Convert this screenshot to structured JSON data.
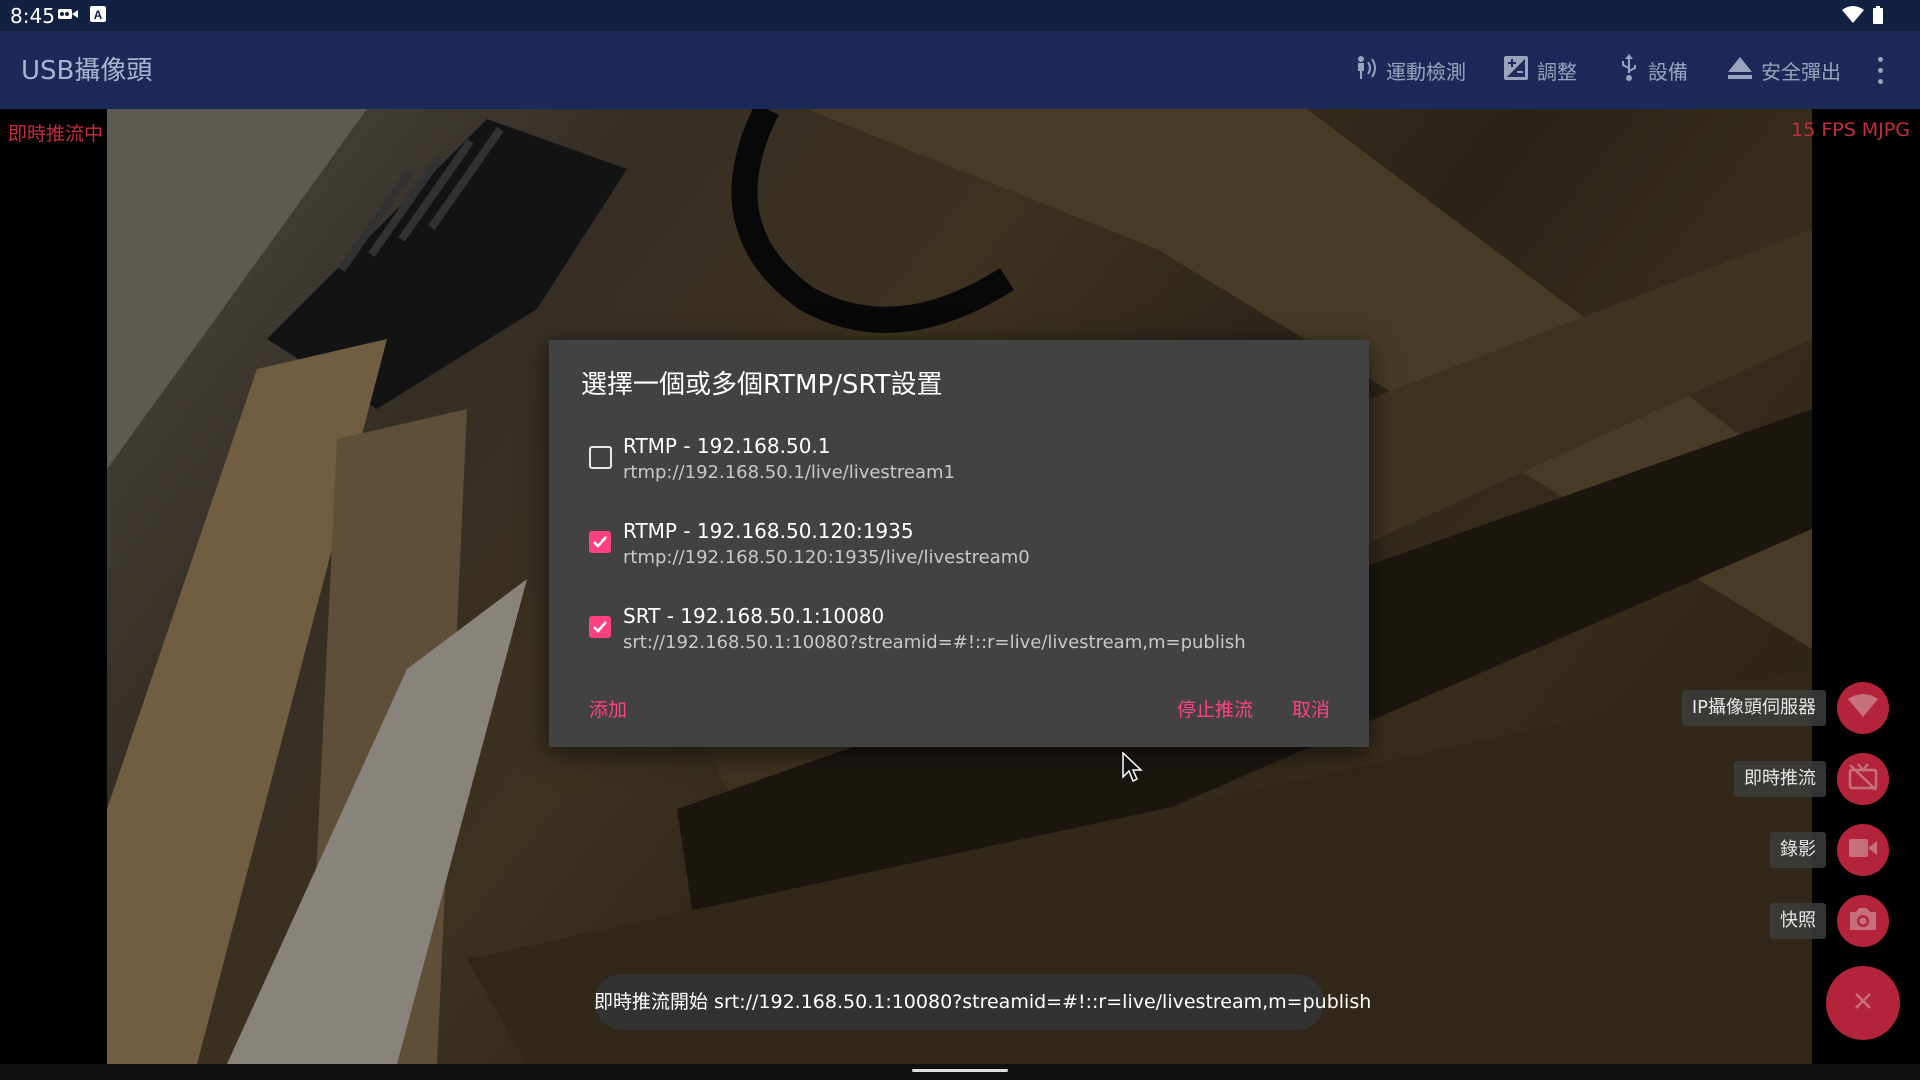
{
  "status_bar": {
    "time": "8:45",
    "icons": [
      "video-camera-icon",
      "keyboard-a-icon",
      "wifi-icon",
      "battery-icon"
    ]
  },
  "app_bar": {
    "title": "USB攝像頭",
    "actions": [
      {
        "icon": "motion-detect-icon",
        "label": "運動檢測"
      },
      {
        "icon": "adjust-icon",
        "label": "調整"
      },
      {
        "icon": "usb-icon",
        "label": "設備"
      },
      {
        "icon": "eject-icon",
        "label": "安全彈出"
      }
    ],
    "overflow_icon": "more-vert-icon"
  },
  "camera": {
    "status_left": "即時推流中",
    "status_right": "15 FPS MJPG"
  },
  "dialog": {
    "title": "選擇一個或多個RTMP/SRT設置",
    "items": [
      {
        "title": "RTMP - 192.168.50.1",
        "url": "rtmp://192.168.50.1/live/livestream1",
        "checked": false
      },
      {
        "title": "RTMP - 192.168.50.120:1935",
        "url": "rtmp://192.168.50.120:1935/live/livestream0",
        "checked": true
      },
      {
        "title": "SRT - 192.168.50.1:10080",
        "url": "srt://192.168.50.1:10080?streamid=#!::r=live/livestream,m=publish",
        "checked": true
      }
    ],
    "add_label": "添加",
    "stop_label": "停止推流",
    "cancel_label": "取消"
  },
  "fab_menu": {
    "items": [
      {
        "label": "IP攝像頭伺服器",
        "icon": "wifi-icon"
      },
      {
        "label": "即時推流",
        "icon": "stream-off-icon"
      },
      {
        "label": "錄影",
        "icon": "videocam-icon"
      },
      {
        "label": "快照",
        "icon": "camera-icon"
      }
    ],
    "close_icon": "close-icon"
  },
  "toast": {
    "text": "即時推流開始 srt://192.168.50.1:10080?streamid=#!::r=live/livestream,m=publish"
  },
  "colors": {
    "accent": "#ff4081",
    "appbar": "#1d2a59",
    "statusbar": "#122042",
    "fab": "#b3243a",
    "overlay_text": "#c62d3c"
  }
}
